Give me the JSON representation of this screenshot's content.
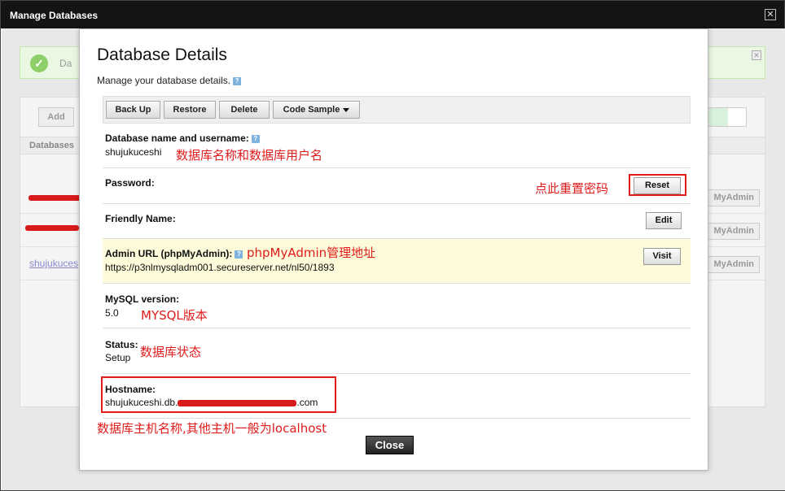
{
  "window": {
    "title": "Manage Databases",
    "close_glyph": "✕"
  },
  "background": {
    "success_text": "Da",
    "add_label": "Add",
    "column_header": "Databases",
    "rows": [
      {
        "link": "",
        "btn": "MyAdmin"
      },
      {
        "link": "",
        "btn": "MyAdmin"
      },
      {
        "link": "shujukuces",
        "btn": "MyAdmin"
      }
    ]
  },
  "modal": {
    "title": "Database Details",
    "subtitle": "Manage your database details.",
    "help_glyph": "?",
    "toolbar": {
      "backup": "Back Up",
      "restore": "Restore",
      "delete": "Delete",
      "code_sample": "Code Sample"
    },
    "db_name": {
      "label": "Database name and username:",
      "value": "shujukuceshi",
      "annotation": "数据库名称和数据库用户名"
    },
    "password": {
      "label": "Password:",
      "annotation": "点此重置密码",
      "button": "Reset"
    },
    "friendly": {
      "label": "Friendly Name:",
      "button": "Edit"
    },
    "admin_url": {
      "label": "Admin URL (phpMyAdmin):",
      "value": "https://p3nlmysqladm001.secureserver.net/nl50/1893",
      "annotation": "phpMyAdmin管理地址",
      "button": "Visit"
    },
    "mysql": {
      "label": "MySQL version:",
      "value": "5.0",
      "annotation": "MYSQL版本"
    },
    "status": {
      "label": "Status:",
      "value": "Setup",
      "annotation": "数据库状态"
    },
    "hostname": {
      "label": "Hostname:",
      "value_prefix": "shujukuceshi.db.",
      "value_suffix": ".com",
      "annotation": "数据库主机名称,其他主机一般为localhost"
    },
    "close_label": "Close"
  },
  "colors": {
    "annotation": "#e01b1b",
    "highlight_row": "#fdfbd9",
    "titlebar": "#141414"
  }
}
